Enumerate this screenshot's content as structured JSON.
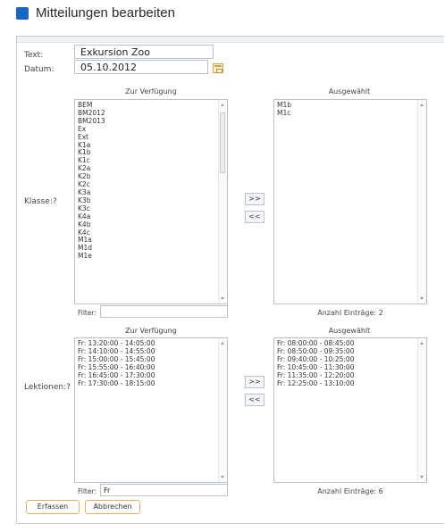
{
  "title": "Mitteilungen bearbeiten",
  "colors": {
    "accent": "#1a66c4",
    "button_border": "#e0b060"
  },
  "form": {
    "text_label": "Text:",
    "text_value": "Exkursion Zoo",
    "datum_label": "Datum:",
    "datum_value": "05.10.2012",
    "calendar_icon": "calendar-icon"
  },
  "klasse": {
    "label": "Klasse:?",
    "available_header": "Zur Verfügung",
    "selected_header": "Ausgewählt",
    "available_items": [
      "BEM",
      "BM2012",
      "BM2013",
      "Ex",
      "Ext",
      "K1a",
      "K1b",
      "K1c",
      "K2a",
      "K2b",
      "K2c",
      "K3a",
      "K3b",
      "K3c",
      "K4a",
      "K4b",
      "K4c",
      "M1a",
      "M1d",
      "M1e"
    ],
    "selected_items": [
      "M1b",
      "M1c"
    ],
    "add_button": ">>",
    "remove_button": "<<",
    "filter_label": "Filter:",
    "filter_value": "",
    "count_text": "Anzahl Einträge: 2"
  },
  "lektionen": {
    "label": "Lektionen:?",
    "available_header": "Zur Verfügung",
    "selected_header": "Ausgewählt",
    "available_items": [
      "Fr: 13:20:00 - 14:05:00",
      "Fr: 14:10:00 - 14:55:00",
      "Fr: 15:00:00 - 15:45:00",
      "Fr: 15:55:00 - 16:40:00",
      "Fr: 16:45:00 - 17:30:00",
      "Fr: 17:30:00 - 18:15:00"
    ],
    "selected_items": [
      "Fr: 08:00:00 - 08:45:00",
      "Fr: 08:50:00 - 09:35:00",
      "Fr: 09:40:00 - 10:25:00",
      "Fr: 10:45:00 - 11:30:00",
      "Fr: 11:35:00 - 12:20:00",
      "Fr: 12:25:00 - 13:10:00"
    ],
    "add_button": ">>",
    "remove_button": "<<",
    "filter_label": "Filter:",
    "filter_value": "Fr",
    "count_text": "Anzahl Einträge: 6"
  },
  "actions": {
    "submit_label": "Erfassen",
    "cancel_label": "Abbrechen"
  }
}
